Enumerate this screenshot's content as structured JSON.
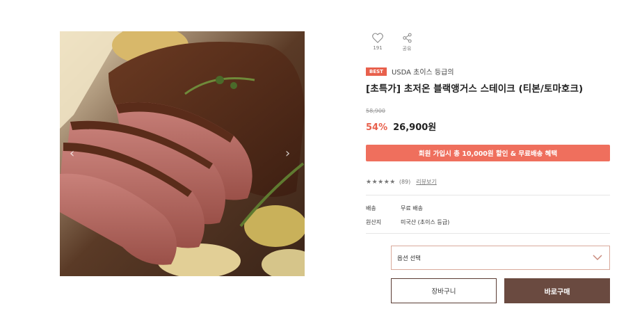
{
  "product": {
    "image_alt": "sliced steak with roasted vegetables",
    "title": "[초특가] 초저온 블랙앵거스 스테이크 (티본/토마호크)",
    "badge": "BEST",
    "grade_label": "USDA 초이스 등급의",
    "original_price": "58,900",
    "discount": "54%",
    "price": "26,900원"
  },
  "actions": {
    "like_count": "191",
    "share_label": "공유"
  },
  "promo": {
    "text": "회원 가입시 총 10,000원 할인 & 무료배송 혜택",
    "color": "#ef6f5d"
  },
  "reviews": {
    "stars": "★★★★★",
    "rating": 5,
    "count": "(89)",
    "link_label": "리뷰보기"
  },
  "info": {
    "shipping_label": "배송",
    "shipping_value": "무료 배송",
    "origin_label": "원산지",
    "origin_value": "미국산 (초이스 등급)"
  },
  "option": {
    "placeholder": "옵션 선택"
  },
  "buttons": {
    "cart": "장바구니",
    "buy": "바로구매",
    "buy_color": "#6a4a40"
  },
  "icons": {
    "prev": "‹",
    "next": "›"
  }
}
